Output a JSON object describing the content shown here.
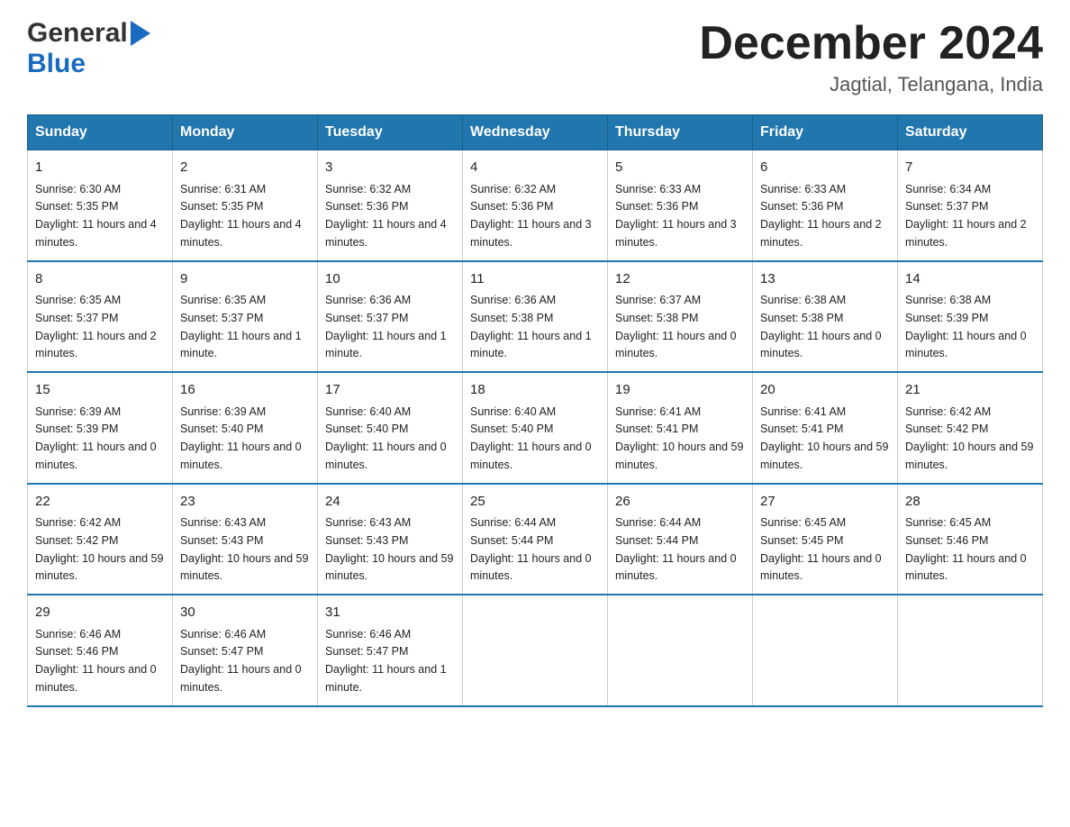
{
  "logo": {
    "general": "General",
    "blue": "Blue",
    "triangle": "▶"
  },
  "header": {
    "month": "December 2024",
    "location": "Jagtial, Telangana, India"
  },
  "weekdays": [
    "Sunday",
    "Monday",
    "Tuesday",
    "Wednesday",
    "Thursday",
    "Friday",
    "Saturday"
  ],
  "weeks": [
    [
      {
        "day": "1",
        "sunrise": "Sunrise: 6:30 AM",
        "sunset": "Sunset: 5:35 PM",
        "daylight": "Daylight: 11 hours and 4 minutes."
      },
      {
        "day": "2",
        "sunrise": "Sunrise: 6:31 AM",
        "sunset": "Sunset: 5:35 PM",
        "daylight": "Daylight: 11 hours and 4 minutes."
      },
      {
        "day": "3",
        "sunrise": "Sunrise: 6:32 AM",
        "sunset": "Sunset: 5:36 PM",
        "daylight": "Daylight: 11 hours and 4 minutes."
      },
      {
        "day": "4",
        "sunrise": "Sunrise: 6:32 AM",
        "sunset": "Sunset: 5:36 PM",
        "daylight": "Daylight: 11 hours and 3 minutes."
      },
      {
        "day": "5",
        "sunrise": "Sunrise: 6:33 AM",
        "sunset": "Sunset: 5:36 PM",
        "daylight": "Daylight: 11 hours and 3 minutes."
      },
      {
        "day": "6",
        "sunrise": "Sunrise: 6:33 AM",
        "sunset": "Sunset: 5:36 PM",
        "daylight": "Daylight: 11 hours and 2 minutes."
      },
      {
        "day": "7",
        "sunrise": "Sunrise: 6:34 AM",
        "sunset": "Sunset: 5:37 PM",
        "daylight": "Daylight: 11 hours and 2 minutes."
      }
    ],
    [
      {
        "day": "8",
        "sunrise": "Sunrise: 6:35 AM",
        "sunset": "Sunset: 5:37 PM",
        "daylight": "Daylight: 11 hours and 2 minutes."
      },
      {
        "day": "9",
        "sunrise": "Sunrise: 6:35 AM",
        "sunset": "Sunset: 5:37 PM",
        "daylight": "Daylight: 11 hours and 1 minute."
      },
      {
        "day": "10",
        "sunrise": "Sunrise: 6:36 AM",
        "sunset": "Sunset: 5:37 PM",
        "daylight": "Daylight: 11 hours and 1 minute."
      },
      {
        "day": "11",
        "sunrise": "Sunrise: 6:36 AM",
        "sunset": "Sunset: 5:38 PM",
        "daylight": "Daylight: 11 hours and 1 minute."
      },
      {
        "day": "12",
        "sunrise": "Sunrise: 6:37 AM",
        "sunset": "Sunset: 5:38 PM",
        "daylight": "Daylight: 11 hours and 0 minutes."
      },
      {
        "day": "13",
        "sunrise": "Sunrise: 6:38 AM",
        "sunset": "Sunset: 5:38 PM",
        "daylight": "Daylight: 11 hours and 0 minutes."
      },
      {
        "day": "14",
        "sunrise": "Sunrise: 6:38 AM",
        "sunset": "Sunset: 5:39 PM",
        "daylight": "Daylight: 11 hours and 0 minutes."
      }
    ],
    [
      {
        "day": "15",
        "sunrise": "Sunrise: 6:39 AM",
        "sunset": "Sunset: 5:39 PM",
        "daylight": "Daylight: 11 hours and 0 minutes."
      },
      {
        "day": "16",
        "sunrise": "Sunrise: 6:39 AM",
        "sunset": "Sunset: 5:40 PM",
        "daylight": "Daylight: 11 hours and 0 minutes."
      },
      {
        "day": "17",
        "sunrise": "Sunrise: 6:40 AM",
        "sunset": "Sunset: 5:40 PM",
        "daylight": "Daylight: 11 hours and 0 minutes."
      },
      {
        "day": "18",
        "sunrise": "Sunrise: 6:40 AM",
        "sunset": "Sunset: 5:40 PM",
        "daylight": "Daylight: 11 hours and 0 minutes."
      },
      {
        "day": "19",
        "sunrise": "Sunrise: 6:41 AM",
        "sunset": "Sunset: 5:41 PM",
        "daylight": "Daylight: 10 hours and 59 minutes."
      },
      {
        "day": "20",
        "sunrise": "Sunrise: 6:41 AM",
        "sunset": "Sunset: 5:41 PM",
        "daylight": "Daylight: 10 hours and 59 minutes."
      },
      {
        "day": "21",
        "sunrise": "Sunrise: 6:42 AM",
        "sunset": "Sunset: 5:42 PM",
        "daylight": "Daylight: 10 hours and 59 minutes."
      }
    ],
    [
      {
        "day": "22",
        "sunrise": "Sunrise: 6:42 AM",
        "sunset": "Sunset: 5:42 PM",
        "daylight": "Daylight: 10 hours and 59 minutes."
      },
      {
        "day": "23",
        "sunrise": "Sunrise: 6:43 AM",
        "sunset": "Sunset: 5:43 PM",
        "daylight": "Daylight: 10 hours and 59 minutes."
      },
      {
        "day": "24",
        "sunrise": "Sunrise: 6:43 AM",
        "sunset": "Sunset: 5:43 PM",
        "daylight": "Daylight: 10 hours and 59 minutes."
      },
      {
        "day": "25",
        "sunrise": "Sunrise: 6:44 AM",
        "sunset": "Sunset: 5:44 PM",
        "daylight": "Daylight: 11 hours and 0 minutes."
      },
      {
        "day": "26",
        "sunrise": "Sunrise: 6:44 AM",
        "sunset": "Sunset: 5:44 PM",
        "daylight": "Daylight: 11 hours and 0 minutes."
      },
      {
        "day": "27",
        "sunrise": "Sunrise: 6:45 AM",
        "sunset": "Sunset: 5:45 PM",
        "daylight": "Daylight: 11 hours and 0 minutes."
      },
      {
        "day": "28",
        "sunrise": "Sunrise: 6:45 AM",
        "sunset": "Sunset: 5:46 PM",
        "daylight": "Daylight: 11 hours and 0 minutes."
      }
    ],
    [
      {
        "day": "29",
        "sunrise": "Sunrise: 6:46 AM",
        "sunset": "Sunset: 5:46 PM",
        "daylight": "Daylight: 11 hours and 0 minutes."
      },
      {
        "day": "30",
        "sunrise": "Sunrise: 6:46 AM",
        "sunset": "Sunset: 5:47 PM",
        "daylight": "Daylight: 11 hours and 0 minutes."
      },
      {
        "day": "31",
        "sunrise": "Sunrise: 6:46 AM",
        "sunset": "Sunset: 5:47 PM",
        "daylight": "Daylight: 11 hours and 1 minute."
      },
      {
        "day": "",
        "sunrise": "",
        "sunset": "",
        "daylight": ""
      },
      {
        "day": "",
        "sunrise": "",
        "sunset": "",
        "daylight": ""
      },
      {
        "day": "",
        "sunrise": "",
        "sunset": "",
        "daylight": ""
      },
      {
        "day": "",
        "sunrise": "",
        "sunset": "",
        "daylight": ""
      }
    ]
  ]
}
